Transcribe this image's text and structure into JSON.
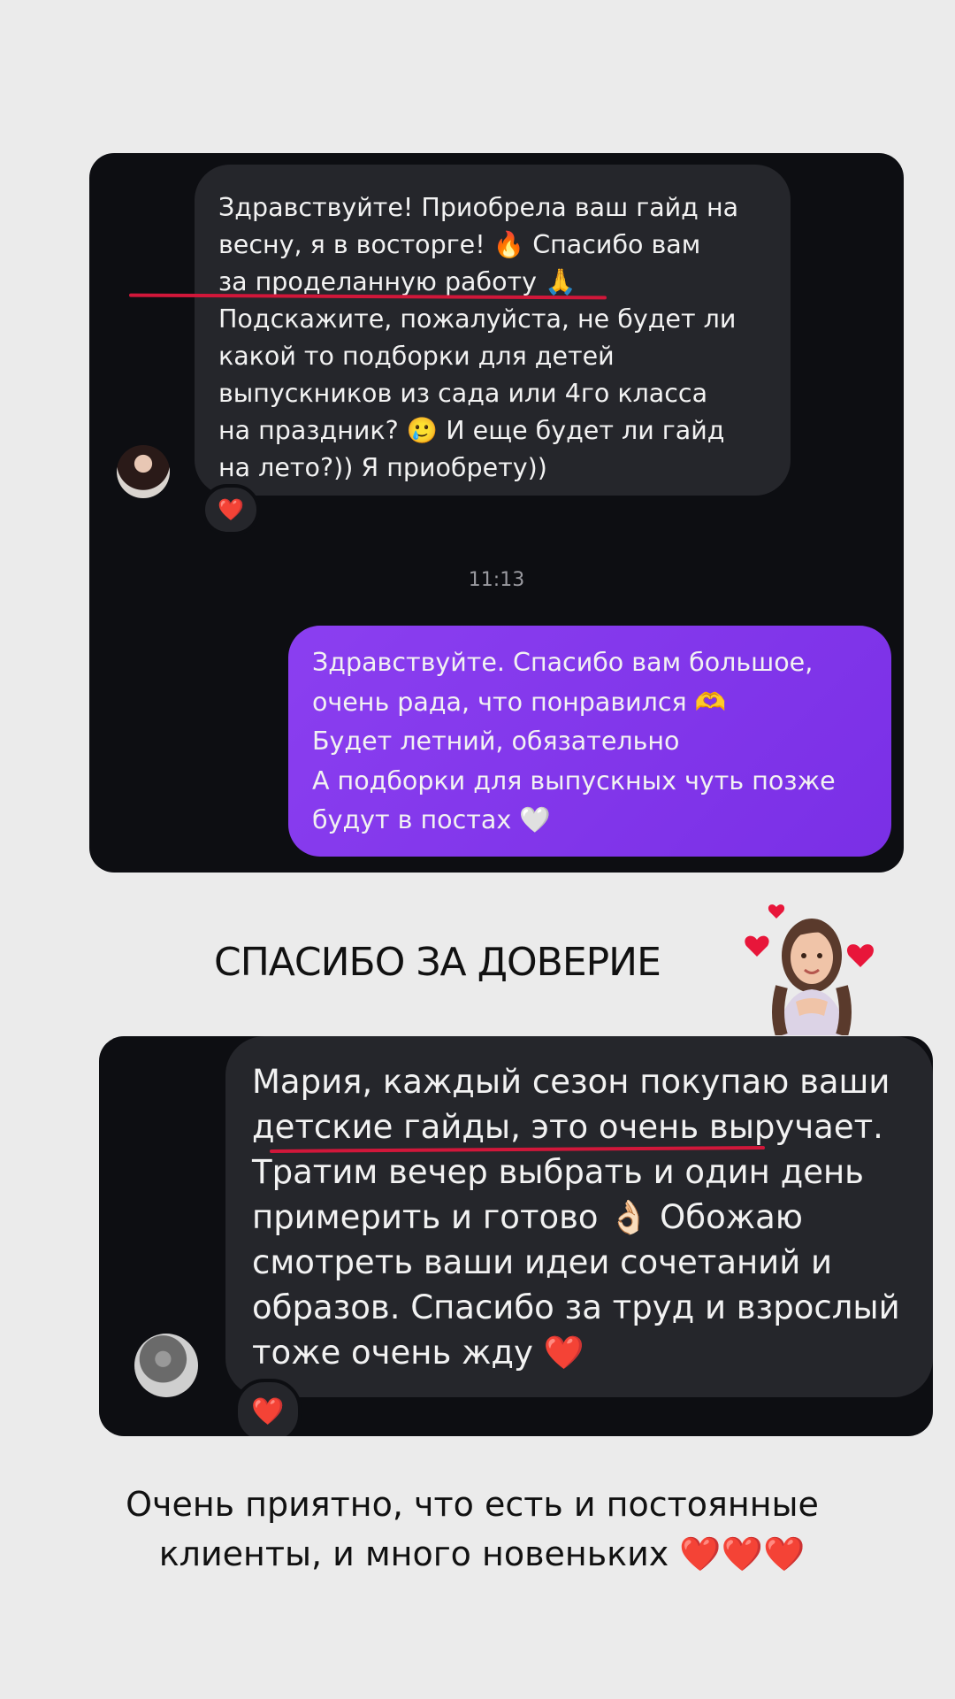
{
  "chat1": {
    "incoming_lines": [
      "Здравствуйте! Приобрела ваш гайд на",
      "весну, я в восторге! 🔥  Спасибо вам",
      "за проделанную работу 🙏",
      "Подскажите, пожалуйста, не будет ли",
      "какой то подборки для детей",
      "выпускников из сада или 4го класса",
      "на праздник? 🥲   И еще будет ли гайд",
      "на лето?)) Я приобрету))"
    ],
    "reaction": "❤️",
    "timestamp": "11:13",
    "outgoing_lines": [
      "Здравствуйте. Спасибо вам большое,",
      "очень рада, что понравился 🫶",
      "Будет летний, обязательно",
      "А подборки для выпускных чуть позже",
      "будут в постах 🤍"
    ]
  },
  "heading": "СПАСИБО ЗА ДОВЕРИЕ",
  "chat2": {
    "incoming_lines": [
      "Мария, каждый сезон покупаю ваши",
      "детские гайды, это очень выручает.",
      "Тратим вечер выбрать и один день",
      "примерить и готово 👌🏻 Обожаю",
      "смотреть ваши идеи сочетаний и",
      "образов. Спасибо за труд и взрослый",
      "тоже очень жду ❤️"
    ],
    "reaction": "❤️"
  },
  "footer": {
    "line1": "Очень приятно, что есть и постоянные",
    "line2": "клиенты, и много новеньких ❤️❤️❤️"
  },
  "colors": {
    "background": "#ebebeb",
    "card": "#0d0e12",
    "incoming_bubble": "#25262b",
    "outgoing_bubble": "#8b3ff0",
    "underline": "#d1173a"
  },
  "icons": {
    "sticker": "girl-with-hearts-sticker",
    "avatar1": "user-avatar",
    "avatar2": "user-avatar"
  }
}
